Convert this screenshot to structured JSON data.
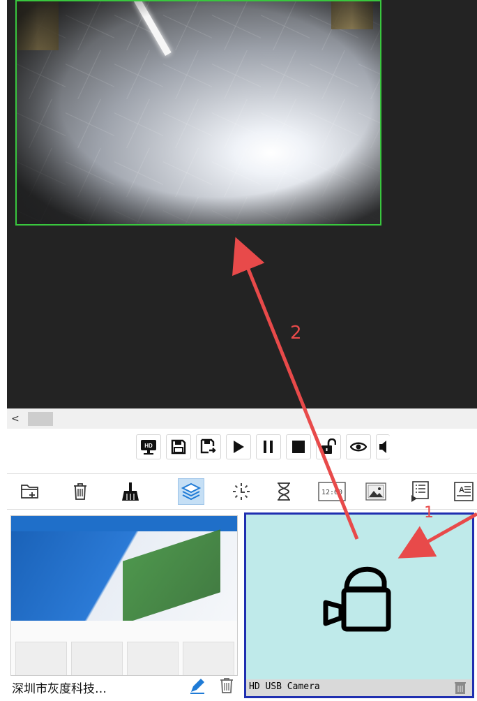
{
  "preview": {
    "background": "#232323",
    "camera_border_color": "#39c73e"
  },
  "scroll": {
    "left_arrow": "<"
  },
  "controls": [
    {
      "icon": "hd-monitor-icon",
      "label": "HD"
    },
    {
      "icon": "save-icon"
    },
    {
      "icon": "save-as-icon"
    },
    {
      "icon": "play-icon"
    },
    {
      "icon": "pause-icon"
    },
    {
      "icon": "stop-icon"
    },
    {
      "icon": "unlock-icon"
    },
    {
      "icon": "eye-icon"
    },
    {
      "icon": "volume-icon"
    }
  ],
  "toolbar": [
    {
      "icon": "add-folder-icon"
    },
    {
      "icon": "trash-icon"
    },
    {
      "icon": "broom-icon"
    },
    {
      "icon": "layers-icon",
      "active": true
    },
    {
      "icon": "clock-dial-icon"
    },
    {
      "icon": "hourglass-icon"
    },
    {
      "icon": "digital-clock-icon",
      "label": "12:00"
    },
    {
      "icon": "image-icon"
    },
    {
      "icon": "playlist-icon"
    },
    {
      "icon": "text-icon"
    }
  ],
  "programs": {
    "web_card": {
      "title": "深圳市灰度科技…"
    },
    "camera_card": {
      "label": "HD USB Camera",
      "background": "#bfeaea",
      "border_color": "#1f2fb0"
    }
  },
  "annotations": {
    "arrow_color": "#e84a4a",
    "label_1": "1",
    "label_2": "2"
  }
}
